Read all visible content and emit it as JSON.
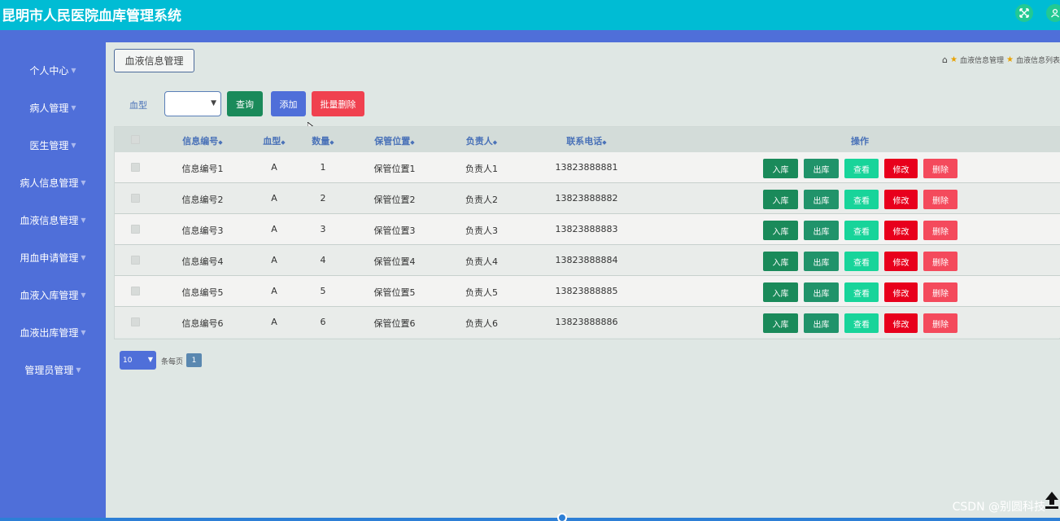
{
  "app": {
    "title": "昆明市人民医院血库管理系统"
  },
  "sidebar": {
    "items": [
      {
        "label": "个人中心"
      },
      {
        "label": "病人管理"
      },
      {
        "label": "医生管理"
      },
      {
        "label": "病人信息管理"
      },
      {
        "label": "血液信息管理"
      },
      {
        "label": "用血申请管理"
      },
      {
        "label": "血液入库管理"
      },
      {
        "label": "血液出库管理"
      },
      {
        "label": "管理员管理"
      }
    ]
  },
  "page": {
    "title": "血液信息管理"
  },
  "breadcrumb": [
    "血液信息管理",
    "血液信息列表"
  ],
  "filter": {
    "label": "血型",
    "select_value": "",
    "search_button": "查询",
    "add_button": "添加",
    "batch_delete_button": "批量删除"
  },
  "table": {
    "columns": [
      "信息编号",
      "血型",
      "数量",
      "保管位置",
      "负责人",
      "联系电话",
      "操作"
    ],
    "actions": [
      "入库",
      "出库",
      "查看",
      "修改",
      "删除"
    ],
    "rows": [
      {
        "id": "信息编号1",
        "type": "A",
        "qty": "1",
        "loc": "保管位置1",
        "owner": "负责人1",
        "phone": "13823888881"
      },
      {
        "id": "信息编号2",
        "type": "A",
        "qty": "2",
        "loc": "保管位置2",
        "owner": "负责人2",
        "phone": "13823888882"
      },
      {
        "id": "信息编号3",
        "type": "A",
        "qty": "3",
        "loc": "保管位置3",
        "owner": "负责人3",
        "phone": "13823888883"
      },
      {
        "id": "信息编号4",
        "type": "A",
        "qty": "4",
        "loc": "保管位置4",
        "owner": "负责人4",
        "phone": "13823888884"
      },
      {
        "id": "信息编号5",
        "type": "A",
        "qty": "5",
        "loc": "保管位置5",
        "owner": "负责人5",
        "phone": "13823888885"
      },
      {
        "id": "信息编号6",
        "type": "A",
        "qty": "6",
        "loc": "保管位置6",
        "owner": "负责人6",
        "phone": "13823888886"
      }
    ]
  },
  "pagination": {
    "page_size": "10",
    "per_page_label": "条每页",
    "current_page": "1"
  },
  "watermark": "CSDN @别圆科技",
  "colors": {
    "topbar": "#00bcd4",
    "sidebar": "#4f6fd9",
    "btn_in": "#1a8a5a",
    "btn_out": "#20936a",
    "btn_view": "#18d49a",
    "btn_edit": "#e8001c",
    "btn_delete": "#f44a5c"
  }
}
